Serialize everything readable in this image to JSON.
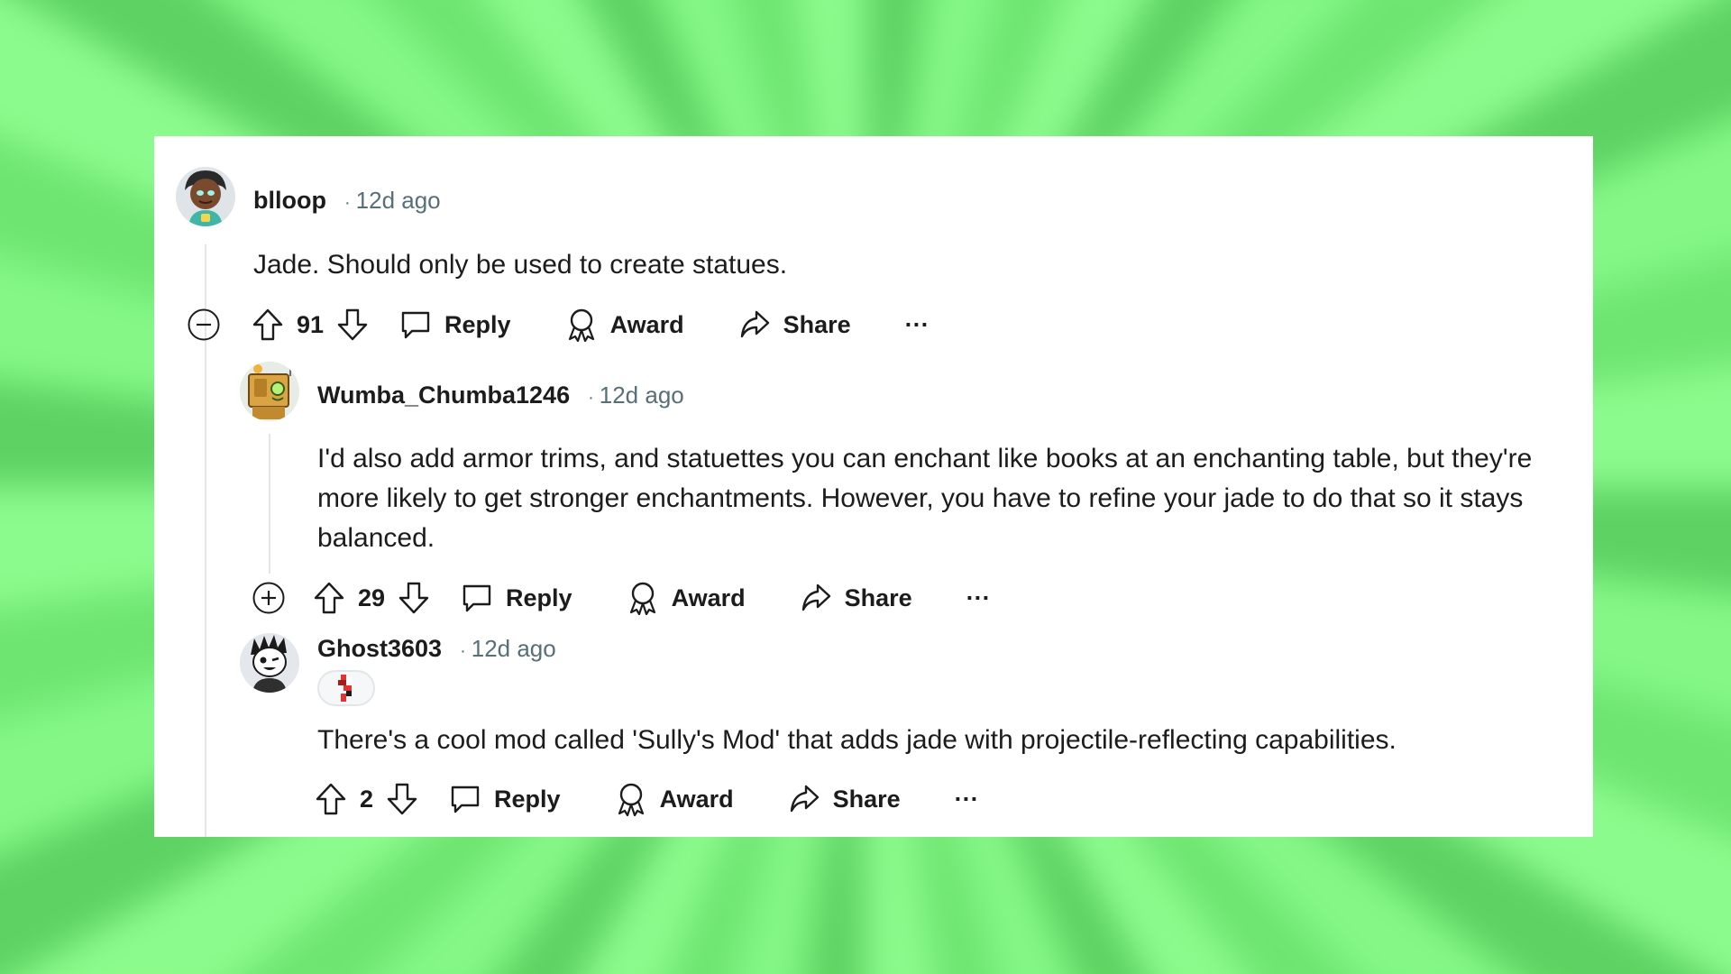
{
  "comments": [
    {
      "username": "blloop",
      "time": "12d ago",
      "body": "Jade. Should only be used to create statues.",
      "votes": "91",
      "toggle_icon": "collapse-minus-icon",
      "actions": {
        "reply": "Reply",
        "award": "Award",
        "share": "Share",
        "more": "···"
      }
    },
    {
      "username": "Wumba_Chumba1246",
      "time": "12d ago",
      "body": "I'd also add armor trims, and statuettes you can enchant like books at an enchanting table, but they're more likely to get stronger enchantments. However, you have to refine your jade to do that so it stays balanced.",
      "votes": "29",
      "toggle_icon": "expand-plus-icon",
      "actions": {
        "reply": "Reply",
        "award": "Award",
        "share": "Share",
        "more": "···"
      }
    },
    {
      "username": "Ghost3603",
      "time": "12d ago",
      "body": "There's a cool mod called 'Sully's Mod' that adds jade with projectile-reflecting capabilities.",
      "votes": "2",
      "flair_icon": "pixel-flair-icon",
      "actions": {
        "reply": "Reply",
        "award": "Award",
        "share": "Share",
        "more": "···"
      }
    }
  ],
  "separator": "·",
  "colors": {
    "text": "#1c1c1c",
    "meta": "#576f76",
    "thread_line": "#e3e6e8",
    "background_green": "#7cf07e"
  }
}
